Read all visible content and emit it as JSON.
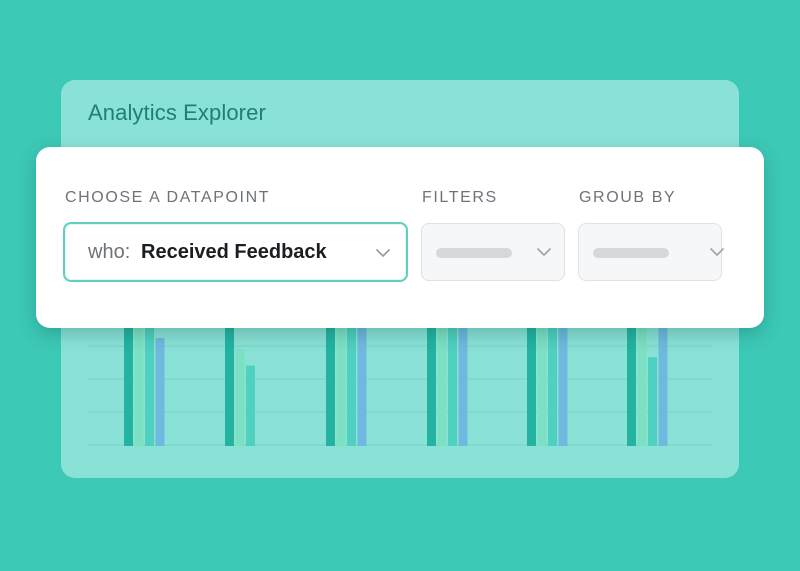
{
  "window": {
    "title": "Analytics Explorer"
  },
  "query": {
    "datapoint_label": "CHOOSE A DATAPOINT",
    "datapoint_prefix": "who:",
    "datapoint_value": "Received Feedback",
    "filters_label": "FILTERS",
    "group_by_label": "GROUB BY"
  },
  "icons": {
    "dropdown": "chevron-down-icon"
  },
  "colors": {
    "background": "#3cc9b6",
    "panel": "#8ae2d6",
    "title": "#1f7f72",
    "series": [
      "#23b3a0",
      "#7be1c2",
      "#4fd0c0",
      "#6fb9e0"
    ]
  },
  "chart_data": {
    "type": "bar",
    "categories": [
      "",
      "",
      "",
      "",
      "",
      ""
    ],
    "series": [
      {
        "values": [
          1.0,
          1.0,
          1.0,
          1.0,
          1.0,
          1.0
        ]
      },
      {
        "values": [
          1.0,
          0.81,
          1.0,
          1.0,
          1.0,
          1.0
        ]
      },
      {
        "values": [
          1.0,
          0.67,
          1.0,
          1.0,
          1.0,
          0.74
        ]
      },
      {
        "values": [
          0.9,
          0.0,
          1.0,
          1.0,
          1.0,
          1.0
        ]
      }
    ],
    "ylim": [
      0,
      1
    ],
    "grid": true
  }
}
